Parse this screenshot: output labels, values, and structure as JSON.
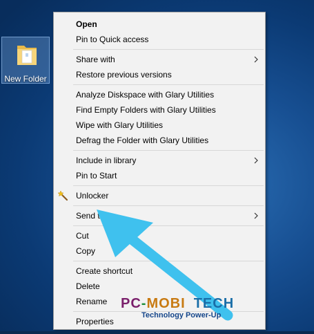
{
  "desktop": {
    "folder_label": "New Folder"
  },
  "menu": {
    "groups": [
      [
        {
          "label": "Open",
          "bold": true
        },
        {
          "label": "Pin to Quick access"
        }
      ],
      [
        {
          "label": "Share with",
          "submenu": true
        },
        {
          "label": "Restore previous versions"
        }
      ],
      [
        {
          "label": "Analyze Diskspace with Glary Utilities"
        },
        {
          "label": "Find Empty Folders with Glary Utilities"
        },
        {
          "label": "Wipe with Glary Utilities"
        },
        {
          "label": "Defrag the Folder with Glary Utilities"
        }
      ],
      [
        {
          "label": "Include in library",
          "submenu": true
        },
        {
          "label": "Pin to Start"
        }
      ],
      [
        {
          "label": "Unlocker",
          "icon": "magic-wand-icon"
        }
      ],
      [
        {
          "label": "Send to",
          "submenu": true
        }
      ],
      [
        {
          "label": "Cut"
        },
        {
          "label": "Copy"
        }
      ],
      [
        {
          "label": "Create shortcut"
        },
        {
          "label": "Delete"
        },
        {
          "label": "Rename"
        }
      ],
      [
        {
          "label": "Properties"
        }
      ]
    ]
  },
  "watermark": {
    "line1_part1": "PC",
    "line1_part2": "-",
    "line1_part3": "MOBI",
    "line1_part4": "TECH",
    "line2": "Technology Power-Up"
  },
  "annotation": {
    "arrow_icon": "arrow-pointer-icon",
    "arrow_color": "#3fc1ee"
  },
  "colors": {
    "menu_bg": "#f2f2f2",
    "separator": "#d7d7d7",
    "desktop_blue": "#174f92"
  }
}
